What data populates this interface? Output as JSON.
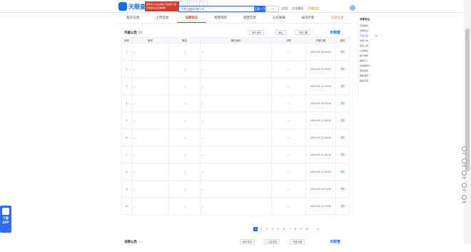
{
  "header": {
    "logo_text": "天眼查",
    "banner_text": "国家中小企业发展子基金旗下官方备案企业征信机构",
    "tabs": [
      "—",
      "—",
      "—"
    ],
    "search_value": "东莞日通速递有限公司",
    "search_button": "天眼一下",
    "secondary_button": "—",
    "links": [
      "应用",
      "企业服务",
      "开通会员"
    ]
  },
  "nav_tabs": [
    {
      "label": "股东信息"
    },
    {
      "label": "上市信息"
    },
    {
      "label": "法律诉讼"
    },
    {
      "label": "经营风险"
    },
    {
      "label": "经营信息"
    },
    {
      "label": "公司发展"
    },
    {
      "label": "知识产权"
    },
    {
      "label": "历史信息"
    }
  ],
  "hearing_panel": {
    "title": "开庭公告",
    "count": "10",
    "note": "—",
    "controls": [
      "案件身份",
      "案由",
      "开庭日期"
    ],
    "brand": "天眼查",
    "columns": [
      "序号",
      "案号",
      "案由",
      "案件身份",
      "法院",
      "开庭日期",
      "操作"
    ],
    "rows": [
      {
        "no": "1",
        "case": "—",
        "cause": "—",
        "parties": "—",
        "court": "—",
        "date": "2024-05-28 09:00",
        "op": "详情"
      },
      {
        "no": "2",
        "case": "—",
        "cause": "—",
        "parties": "—",
        "court": "—",
        "date": "2024-05-21 09:00",
        "op": "详情"
      },
      {
        "no": "3",
        "case": "—",
        "cause": "—",
        "parties": "—",
        "court": "—",
        "date": "2024-05-21 09:00",
        "op": "详情"
      },
      {
        "no": "4",
        "case": "—",
        "cause": "—",
        "parties": "—",
        "court": "—",
        "date": "2024-05-16 09:30",
        "op": "详情"
      },
      {
        "no": "5",
        "case": "—",
        "cause": "—",
        "parties": "—",
        "court": "—",
        "date": "2024-05-13 09:30",
        "op": "详情"
      },
      {
        "no": "6",
        "case": "—",
        "cause": "—",
        "parties": "—",
        "court": "—",
        "date": "2024-05-12 09:30",
        "op": "详情"
      },
      {
        "no": "7",
        "case": "—",
        "cause": "—",
        "parties": "—",
        "court": "—",
        "date": "2024-05-11 09:30",
        "op": "详情"
      },
      {
        "no": "8",
        "case": "—",
        "cause": "—",
        "parties": "—",
        "court": "—",
        "date": "2024-05-10 09:00",
        "op": "详情"
      },
      {
        "no": "9",
        "case": "—",
        "cause": "—",
        "parties": "—",
        "court": "—",
        "date": "2024-05-10 14:00",
        "op": "详情"
      },
      {
        "no": "10",
        "case": "—",
        "cause": "—",
        "parties": "—",
        "court": "—",
        "date": "2024-05-10 10:00",
        "op": "详情"
      }
    ],
    "pager": [
      "1",
      "2",
      "3",
      "4",
      "5",
      "6",
      "7",
      "8",
      "9",
      "10",
      "...",
      ">"
    ]
  },
  "court_panel": {
    "title": "法院公告",
    "count": "—",
    "note": "—",
    "controls": [
      "案件身份",
      "公告类型",
      "刊登日期"
    ],
    "brand": "天眼查",
    "columns": [
      "序号",
      "案号",
      "案由",
      "案件身份",
      "公告类型",
      "刊登日期",
      "操作"
    ],
    "first_row": {
      "no": "1",
      "case": "—",
      "cause": "—",
      "parties": "—",
      "court": "—",
      "date": "—",
      "op": "详情"
    }
  },
  "right_nav": {
    "title": "法律诉讼",
    "items": [
      {
        "label": "司法解析",
        "count": ""
      },
      {
        "label": "法律诉讼",
        "count": ""
      },
      {
        "label": "开庭公告",
        "count": "10"
      },
      {
        "label": "法院公告",
        "count": ""
      },
      {
        "label": "送达公告",
        "count": ""
      },
      {
        "label": "立案信息",
        "count": ""
      },
      {
        "label": "破产重整",
        "count": ""
      },
      {
        "label": "被执行人",
        "count": ""
      },
      {
        "label": "失信被执行",
        "count": ""
      },
      {
        "label": "终本案件",
        "count": ""
      },
      {
        "label": "限制消费",
        "count": ""
      },
      {
        "label": "股权冻结",
        "count": ""
      }
    ]
  },
  "tools": [
    "APP",
    "在线",
    "反馈",
    "关注",
    "顶部"
  ],
  "app_tile": {
    "line1": "下载",
    "line2": "APP"
  },
  "colors": {
    "accent": "#2f6bf5",
    "active": "#d63a2d"
  }
}
